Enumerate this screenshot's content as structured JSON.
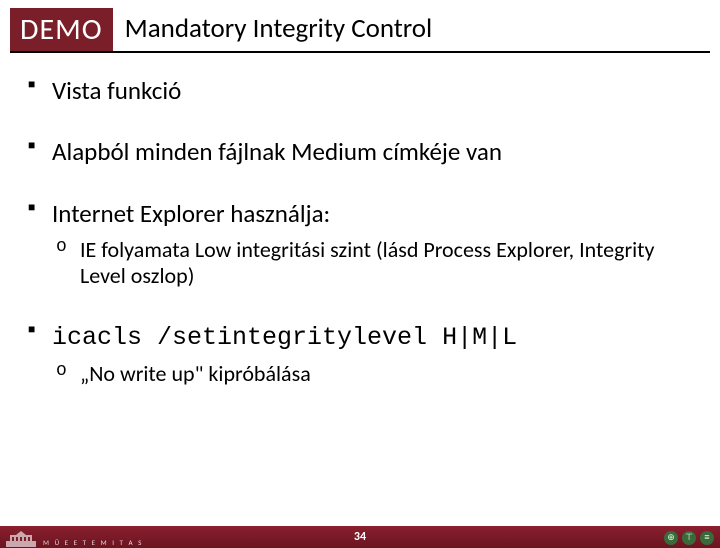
{
  "header": {
    "badge": "DEMO",
    "title": "Mandatory Integrity Control"
  },
  "bullets": {
    "b1": "Vista funkció",
    "b2": "Alapból minden fájlnak Medium címkéje van",
    "b3": "Internet Explorer használja:",
    "b3_sub1": "IE folyamata Low integritási szint (lásd Process Explorer, Integrity Level oszlop)",
    "b4": "icacls /setintegritylevel H|M|L",
    "b4_sub1": "„No write up\" kipróbálása"
  },
  "footer": {
    "page": "34",
    "left_text": "M Ü E   E T E M   I T A S"
  }
}
